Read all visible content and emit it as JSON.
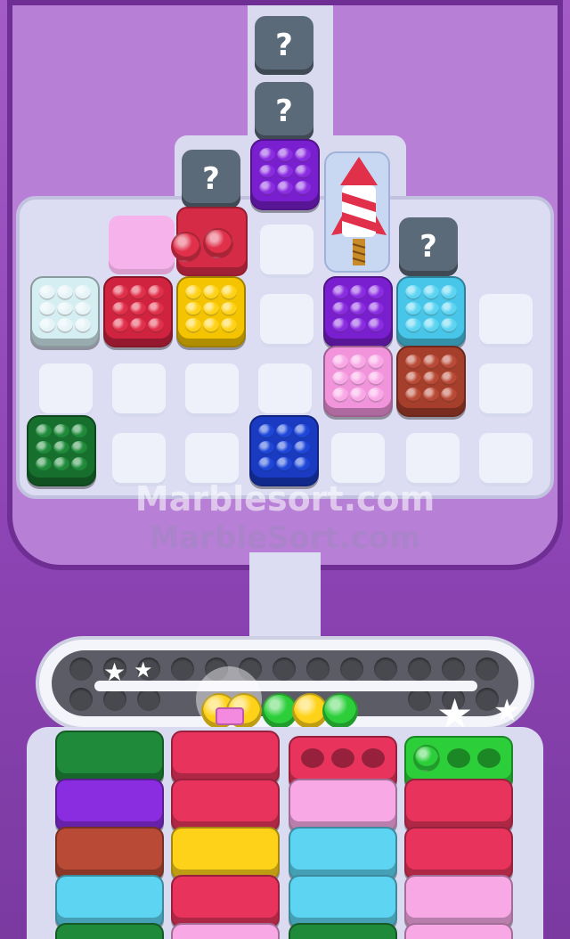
{
  "game": {
    "watermarks": [
      "Marblesort.com",
      "MarbleSort.com"
    ],
    "mystery_label": "?",
    "colors": {
      "red": "#e0304a",
      "crimson": "#e8345c",
      "pink": "#f9a8e6",
      "yellow": "#ffd21a",
      "purple": "#8a2de0",
      "cyan": "#5cd4f2",
      "brown": "#b84a36",
      "green": "#1f8a3a",
      "blue": "#1e47d8",
      "white": "#e6f4f8",
      "lime": "#2ccf3a",
      "grey": "#5b6a78"
    },
    "board_blocks": [
      {
        "name": "block-white",
        "color": "white"
      },
      {
        "name": "block-red-left",
        "color": "red"
      },
      {
        "name": "block-yellow",
        "color": "yellow"
      },
      {
        "name": "block-purple-top",
        "color": "purple"
      },
      {
        "name": "block-purple-mid",
        "color": "purple"
      },
      {
        "name": "block-cyan",
        "color": "cyan"
      },
      {
        "name": "block-pink",
        "color": "pink"
      },
      {
        "name": "block-brown",
        "color": "brown"
      },
      {
        "name": "block-green",
        "color": "green"
      },
      {
        "name": "block-blue",
        "color": "blue"
      }
    ],
    "conveyor_marbles": [
      "yellow",
      "green",
      "yellow",
      "green"
    ],
    "bins": [
      [
        "green",
        "purple",
        "brown",
        "cyan"
      ],
      [
        "crimson",
        "crimson",
        "yellow",
        "crimson"
      ],
      [
        "crimson",
        "pink",
        "cyan",
        "cyan"
      ],
      [
        "lime",
        "crimson",
        "crimson",
        "pink"
      ]
    ]
  }
}
